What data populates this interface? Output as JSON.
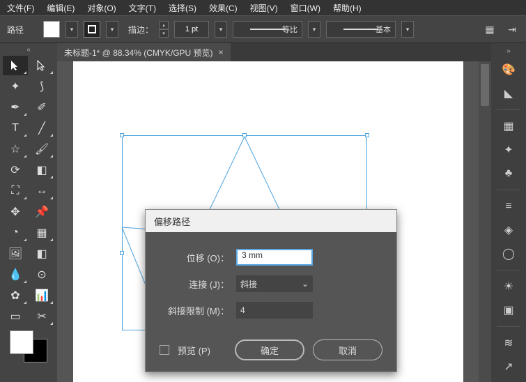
{
  "menu": {
    "file": "文件(F)",
    "edit": "编辑(E)",
    "object": "对象(O)",
    "type": "文字(T)",
    "select": "选择(S)",
    "effect": "效果(C)",
    "view": "视图(V)",
    "window": "窗口(W)",
    "help": "帮助(H)"
  },
  "options": {
    "path": "路径",
    "stroke": "描边：",
    "pt": "1 pt",
    "profile": "等比",
    "brush": "基本"
  },
  "tab": {
    "title": "未标题-1* @ 88.34% (CMYK/GPU 预览)",
    "close": "×"
  },
  "dialog": {
    "title": "偏移路径",
    "offset_label": "位移 (O)：",
    "offset_value": "3 mm",
    "join_label": "连接 (J)：",
    "join_value": "斜接",
    "limit_label": "斜接限制 (M)：",
    "limit_value": "4",
    "preview": "预览 (P)",
    "ok": "确定",
    "cancel": "取消"
  }
}
